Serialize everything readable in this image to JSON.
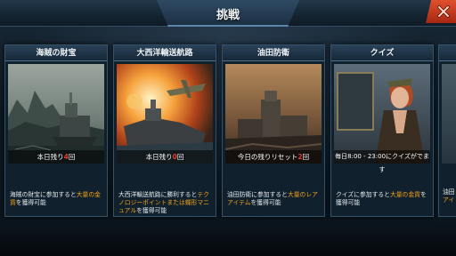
{
  "header": {
    "title": "挑戦"
  },
  "cards": [
    {
      "title": "海賊の財宝",
      "remain_prefix": "本日残り",
      "remain_num": "4",
      "remain_suffix": "回",
      "desc_a": "海賊の財宝に参加すると",
      "desc_hl": "大量の金貨",
      "desc_b": "を獲得可能"
    },
    {
      "title": "大西洋輸送航路",
      "remain_prefix": "本日残り",
      "remain_num": "0",
      "remain_suffix": "回",
      "desc_a": "大西洋輸送航路に勝利すると",
      "desc_hl": "テクノロジーポイントまたは蝶形マニュアル",
      "desc_b": "を獲得可能"
    },
    {
      "title": "油田防衛",
      "remain_prefix": "今日の残りリセット",
      "remain_num": "2",
      "remain_suffix": "回",
      "desc_a": "油田防衛に参加すると",
      "desc_hl": "大量のレアアイテム",
      "desc_b": "を獲得可能"
    },
    {
      "title": "クイズ",
      "remain_text": "毎日8:00 - 23:00にクイズがでます",
      "desc_a": "クイズに参加すると",
      "desc_hl": "大量の金貨",
      "desc_b": "を獲得可能"
    }
  ],
  "peek": {
    "text_a": "油田",
    "text_b": "アイ"
  },
  "colors": {
    "highlight": "#f3a21b",
    "remain_num": "#e63a2a",
    "close": "#d2401f"
  },
  "icons": {
    "close": "close-x-icon"
  }
}
